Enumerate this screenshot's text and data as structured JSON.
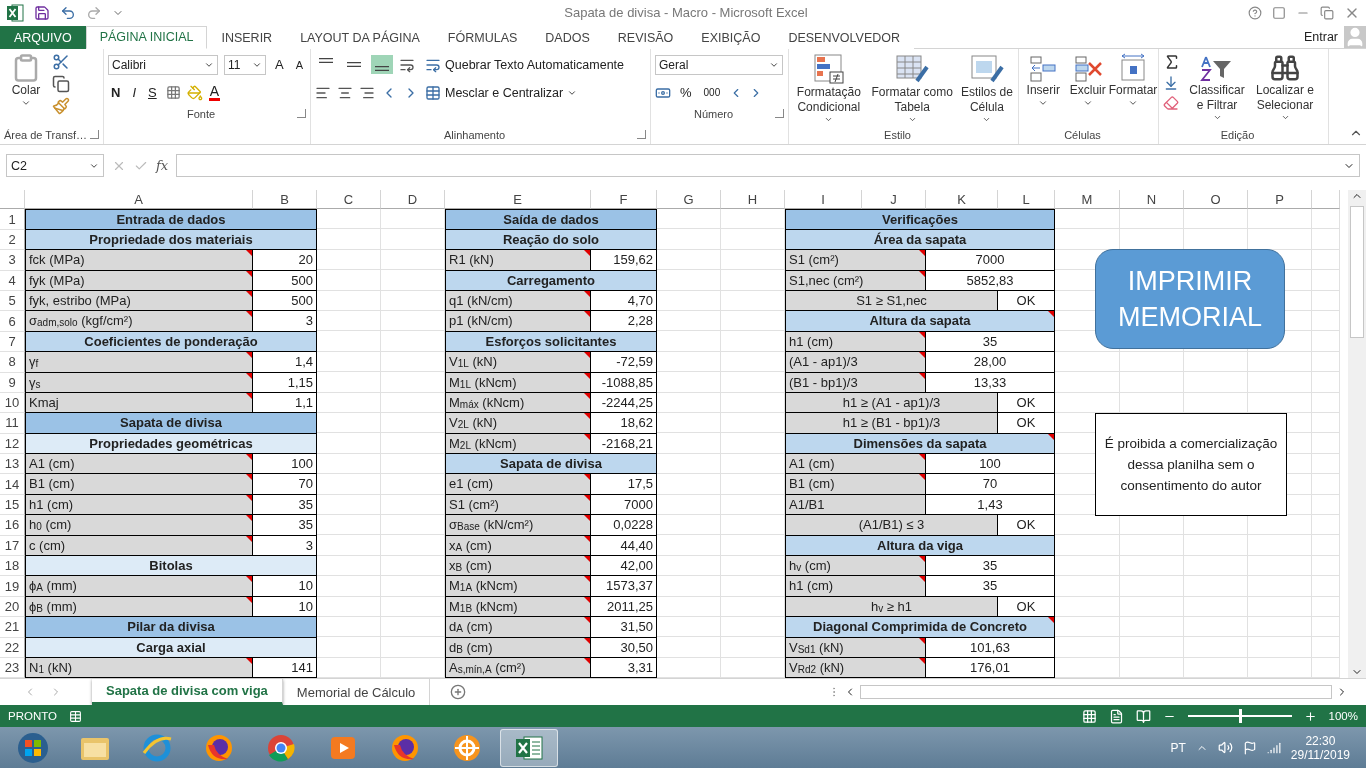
{
  "window": {
    "title": "Sapata de divisa - Macro - Microsoft Excel"
  },
  "ribbon_tabs": [
    {
      "label": "ARQUIVO",
      "kind": "file",
      "selected": false
    },
    {
      "label": "PÁGINA INICIAL",
      "kind": "tab",
      "selected": true
    },
    {
      "label": "INSERIR",
      "kind": "tab",
      "selected": false
    },
    {
      "label": "LAYOUT DA PÁGINA",
      "kind": "tab",
      "selected": false
    },
    {
      "label": "FÓRMULAS",
      "kind": "tab",
      "selected": false
    },
    {
      "label": "DADOS",
      "kind": "tab",
      "selected": false
    },
    {
      "label": "REVISÃO",
      "kind": "tab",
      "selected": false
    },
    {
      "label": "EXIBIÇÃO",
      "kind": "tab",
      "selected": false
    },
    {
      "label": "DESENVOLVEDOR",
      "kind": "tab",
      "selected": false
    }
  ],
  "account": "Entrar",
  "ribbon": {
    "clipboard": {
      "paste": "Colar",
      "label": "Área de Transf…"
    },
    "font": {
      "name": "Calibri",
      "size": "11",
      "grow": "A",
      "shrink": "A",
      "bold": "N",
      "italic": "I",
      "underline": "S",
      "font_color_button": "A",
      "label": "Fonte"
    },
    "alignment": {
      "vertical": [
        {
          "kind": "top",
          "selected": false
        },
        {
          "kind": "middle",
          "selected": false
        },
        {
          "kind": "bottom",
          "selected": true
        }
      ],
      "wrap": "Quebrar Texto Automaticamente",
      "merge": "Mesclar e Centralizar",
      "label": "Alinhamento"
    },
    "number": {
      "format": "Geral",
      "percent": "%",
      "thousands": "000",
      "label": "Número"
    },
    "styles": {
      "buttons": [
        {
          "kind": "conditional",
          "label": "Formatação Condicional"
        },
        {
          "kind": "table",
          "label": "Formatar como Tabela"
        },
        {
          "kind": "cell-styles",
          "label": "Estilos de Célula"
        }
      ],
      "label": "Estilo"
    },
    "cells": {
      "buttons": [
        {
          "kind": "insert",
          "label": "Inserir"
        },
        {
          "kind": "delete",
          "label": "Excluir"
        },
        {
          "kind": "format",
          "label": "Formatar"
        }
      ],
      "label": "Células"
    },
    "editing": {
      "buttons": [
        {
          "kind": "sort",
          "label": "Classificar e Filtrar"
        },
        {
          "kind": "find",
          "label": "Localizar e Selecionar"
        }
      ],
      "label": "Edição"
    }
  },
  "formula_bar": {
    "name_box": "C2",
    "function": "fx"
  },
  "columns": [
    "A",
    "B",
    "C",
    "D",
    "E",
    "F",
    "G",
    "H",
    "I",
    "J",
    "K",
    "L",
    "M",
    "N",
    "O",
    "P"
  ],
  "row_numbers": [
    "1",
    "2",
    "3",
    "4",
    "5",
    "6",
    "7",
    "8",
    "9",
    "10",
    "11",
    "12",
    "13",
    "14",
    "15",
    "16",
    "17",
    "18",
    "19",
    "20",
    "21",
    "22",
    "23"
  ],
  "tables": [
    {
      "kind": "input",
      "rows": [
        {
          "kind": "header",
          "text": "Entrada de dados",
          "note": false
        },
        {
          "kind": "section",
          "text": "Propriedade dos materiais",
          "note": false
        },
        {
          "kind": "field",
          "label": "fck (MPa)",
          "value": "20",
          "note": true
        },
        {
          "kind": "field",
          "label": "fyk (MPa)",
          "value": "500",
          "note": true
        },
        {
          "kind": "field",
          "label": "fyk, estribo (MPa)",
          "value": "500",
          "note": true
        },
        {
          "kind": "field",
          "label": "σ$_{adm,solo}$ (kgf/cm²)",
          "value": "3",
          "note": true
        },
        {
          "kind": "section",
          "text": "Coeficientes de ponderação",
          "note": false
        },
        {
          "kind": "field",
          "label": "γ$_{f}$",
          "value": "1,4",
          "note": true
        },
        {
          "kind": "field",
          "label": "γ$_{s}$",
          "value": "1,15",
          "note": true
        },
        {
          "kind": "field",
          "label": "Kmaj",
          "value": "1,1",
          "note": true
        },
        {
          "kind": "header",
          "text": "Sapata de divisa",
          "note": false
        },
        {
          "kind": "subsection",
          "text": "Propriedades geométricas",
          "note": false
        },
        {
          "kind": "field",
          "label": "A1 (cm)",
          "value": "100",
          "note": true
        },
        {
          "kind": "field",
          "label": "B1 (cm)",
          "value": "70",
          "note": true
        },
        {
          "kind": "field",
          "label": "h1 (cm)",
          "value": "35",
          "note": true
        },
        {
          "kind": "field",
          "label": "h$_{0}$ (cm)",
          "value": "35",
          "note": true
        },
        {
          "kind": "field",
          "label": "c (cm)",
          "value": "3",
          "note": true
        },
        {
          "kind": "subsection",
          "text": "Bitolas",
          "note": false
        },
        {
          "kind": "field",
          "label": "ϕ$_{A}$ (mm)",
          "value": "10",
          "note": true
        },
        {
          "kind": "field",
          "label": "ϕ$_{B}$ (mm)",
          "value": "10",
          "note": true
        },
        {
          "kind": "header",
          "text": "Pilar da divisa",
          "note": false
        },
        {
          "kind": "subsection",
          "text": "Carga axial",
          "note": false
        },
        {
          "kind": "field",
          "label": "N$_{1}$ (kN)",
          "value": "141",
          "note": true
        }
      ]
    },
    {
      "kind": "output",
      "rows": [
        {
          "kind": "header",
          "text": "Saída de dados",
          "note": false
        },
        {
          "kind": "section",
          "text": "Reação do solo",
          "note": false
        },
        {
          "kind": "field",
          "label": "R1 (kN)",
          "value": "159,62",
          "note": true
        },
        {
          "kind": "section",
          "text": "Carregamento",
          "note": false
        },
        {
          "kind": "field",
          "label": "q1 (kN/cm)",
          "value": "4,70",
          "note": true
        },
        {
          "kind": "field",
          "label": "p1 (kN/cm)",
          "value": "2,28",
          "note": true
        },
        {
          "kind": "section",
          "text": "Esforços solicitantes",
          "note": false
        },
        {
          "kind": "field",
          "label": "V$_{1L}$ (kN)",
          "value": "-72,59",
          "note": true
        },
        {
          "kind": "field",
          "label": "M$_{1L}$ (kNcm)",
          "value": "-1088,85",
          "note": true
        },
        {
          "kind": "field",
          "label": "M$_{máx}$ (kNcm)",
          "value": "-2244,25",
          "note": true
        },
        {
          "kind": "field",
          "label": "V$_{2L}$ (kN)",
          "value": "18,62",
          "note": true
        },
        {
          "kind": "field",
          "label": "M$_{2L}$ (kNcm)",
          "value": "-2168,21",
          "note": true
        },
        {
          "kind": "section",
          "text": "Sapata de divisa",
          "note": false
        },
        {
          "kind": "field",
          "label": "e1 (cm)",
          "value": "17,5",
          "note": true
        },
        {
          "kind": "field",
          "label": "S1 (cm²)",
          "value": "7000",
          "note": true
        },
        {
          "kind": "field",
          "label": "σ$_{Base}$ (kN/cm²)",
          "value": "0,0228",
          "note": true
        },
        {
          "kind": "field",
          "label": "x$_{A}$ (cm)",
          "value": "44,40",
          "note": true
        },
        {
          "kind": "field",
          "label": "x$_{B}$ (cm)",
          "value": "42,00",
          "note": true
        },
        {
          "kind": "field",
          "label": "M$_{1A}$ (kNcm)",
          "value": "1573,37",
          "note": true
        },
        {
          "kind": "field",
          "label": "M$_{1B}$ (kNcm)",
          "value": "2011,25",
          "note": true
        },
        {
          "kind": "field",
          "label": "d$_{A}$ (cm)",
          "value": "31,50",
          "note": true
        },
        {
          "kind": "field",
          "label": "d$_{B}$ (cm)",
          "value": "30,50",
          "note": true
        },
        {
          "kind": "field",
          "label": "A$_{s,mín,A}$ (cm²)",
          "value": "3,31",
          "note": true
        }
      ]
    },
    {
      "kind": "verification",
      "rows": [
        {
          "kind": "header",
          "text": "Verificações",
          "note": false
        },
        {
          "kind": "section",
          "text": "Área da sapata",
          "note": false
        },
        {
          "kind": "field",
          "label": "S1 (cm²)",
          "value": "7000",
          "note": true
        },
        {
          "kind": "field",
          "label": "S1,nec (cm²)",
          "value": "5852,83",
          "note": true
        },
        {
          "kind": "check",
          "label": "S1 ≥ S1,nec",
          "value": "OK",
          "note": false
        },
        {
          "kind": "section",
          "text": "Altura da sapata",
          "note": true
        },
        {
          "kind": "field",
          "label": "h1 (cm)",
          "value": "35",
          "note": true
        },
        {
          "kind": "field",
          "label": "(A1 - ap1)/3",
          "value": "28,00",
          "note": true
        },
        {
          "kind": "field",
          "label": "(B1 - bp1)/3",
          "value": "13,33",
          "note": true
        },
        {
          "kind": "check",
          "label": "h1 ≥ (A1 - ap1)/3",
          "value": "OK",
          "note": false
        },
        {
          "kind": "check",
          "label": "h1 ≥ (B1 - bp1)/3",
          "value": "OK",
          "note": false
        },
        {
          "kind": "section",
          "text": "Dimensões da sapata",
          "note": true
        },
        {
          "kind": "field",
          "label": "A1 (cm)",
          "value": "100",
          "note": true
        },
        {
          "kind": "field",
          "label": "B1 (cm)",
          "value": "70",
          "note": true
        },
        {
          "kind": "field",
          "label": "A1/B1",
          "value": "1,43",
          "note": false
        },
        {
          "kind": "check",
          "label": "(A1/B1) ≤ 3",
          "value": "OK",
          "note": false
        },
        {
          "kind": "section",
          "text": "Altura da viga",
          "note": false
        },
        {
          "kind": "field",
          "label": "h$_{v}$ (cm)",
          "value": "35",
          "note": true
        },
        {
          "kind": "field",
          "label": "h1 (cm)",
          "value": "35",
          "note": true
        },
        {
          "kind": "check",
          "label": "h$_{v}$ ≥ h1",
          "value": "OK",
          "note": false
        },
        {
          "kind": "section",
          "text": "Diagonal Comprimida de Concreto",
          "note": true
        },
        {
          "kind": "field",
          "label": "V$_{Sd1}$ (kN)",
          "value": "101,63",
          "note": true
        },
        {
          "kind": "field",
          "label": "V$_{Rd2}$ (kN)",
          "value": "176,01",
          "note": true
        }
      ]
    }
  ],
  "shapes": {
    "print_button": "IMPRIMIR MEMORIAL",
    "notice": "É proibida a comercialização dessa planilha sem o consentimento do autor"
  },
  "sheet_tabs": [
    {
      "label": "Sapata de divisa com viga",
      "selected": true
    },
    {
      "label": "Memorial de Cálculo",
      "selected": false
    }
  ],
  "status_bar": {
    "text": "PRONTO",
    "zoom": "100%",
    "zoom_slider": {
      "level": 0.5
    }
  },
  "taskbar": {
    "apps": [
      {
        "kind": "start",
        "selected": false
      },
      {
        "kind": "folder",
        "selected": false
      },
      {
        "kind": "ie",
        "selected": false
      },
      {
        "kind": "firefox",
        "selected": false
      },
      {
        "kind": "chrome",
        "selected": false
      },
      {
        "kind": "media",
        "selected": false
      },
      {
        "kind": "firefox",
        "selected": false
      },
      {
        "kind": "wheel",
        "selected": false
      },
      {
        "kind": "excel",
        "selected": true
      }
    ],
    "language": "PT",
    "time": "22:30",
    "date": "29/11/2019"
  }
}
